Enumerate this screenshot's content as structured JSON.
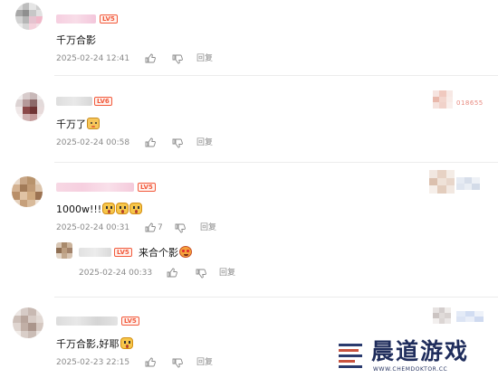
{
  "colors": {
    "level_badge": "#f25a3c",
    "meta_text": "#8a8a8a",
    "watermark_text": "#1f2d5c"
  },
  "comments": [
    {
      "level": "LV5",
      "text": "千万合影",
      "time": "2025-02-24 12:41",
      "like_count": "",
      "reply_label": "回复"
    },
    {
      "level": "LV6",
      "text": "千万了",
      "emoji": "tiger-emoji",
      "time": "2025-02-24 00:58",
      "like_count": "",
      "reply_label": "回复",
      "side_label": "018655"
    },
    {
      "level": "LV5",
      "text": "1000w!!!",
      "emoji": "shocked-emoji",
      "time": "2025-02-24 00:31",
      "like_count": "7",
      "reply_label": "回复",
      "reply": {
        "level": "LV5",
        "text": "来合个影",
        "emoji": "heart-eyes-emoji",
        "time": "2025-02-24 00:33",
        "reply_label": "回复"
      }
    },
    {
      "level": "LV5",
      "text": "千万合影,好耶",
      "emoji": "shocked-emoji",
      "time": "2025-02-23 22:15",
      "like_count": "",
      "reply_label": "回复"
    }
  ],
  "icons": {
    "like": "thumbs-up-icon",
    "dislike": "thumbs-down-icon"
  },
  "watermark": {
    "title": "晨道游戏",
    "url": "WWW.CHEMDOKTOR.CC"
  }
}
